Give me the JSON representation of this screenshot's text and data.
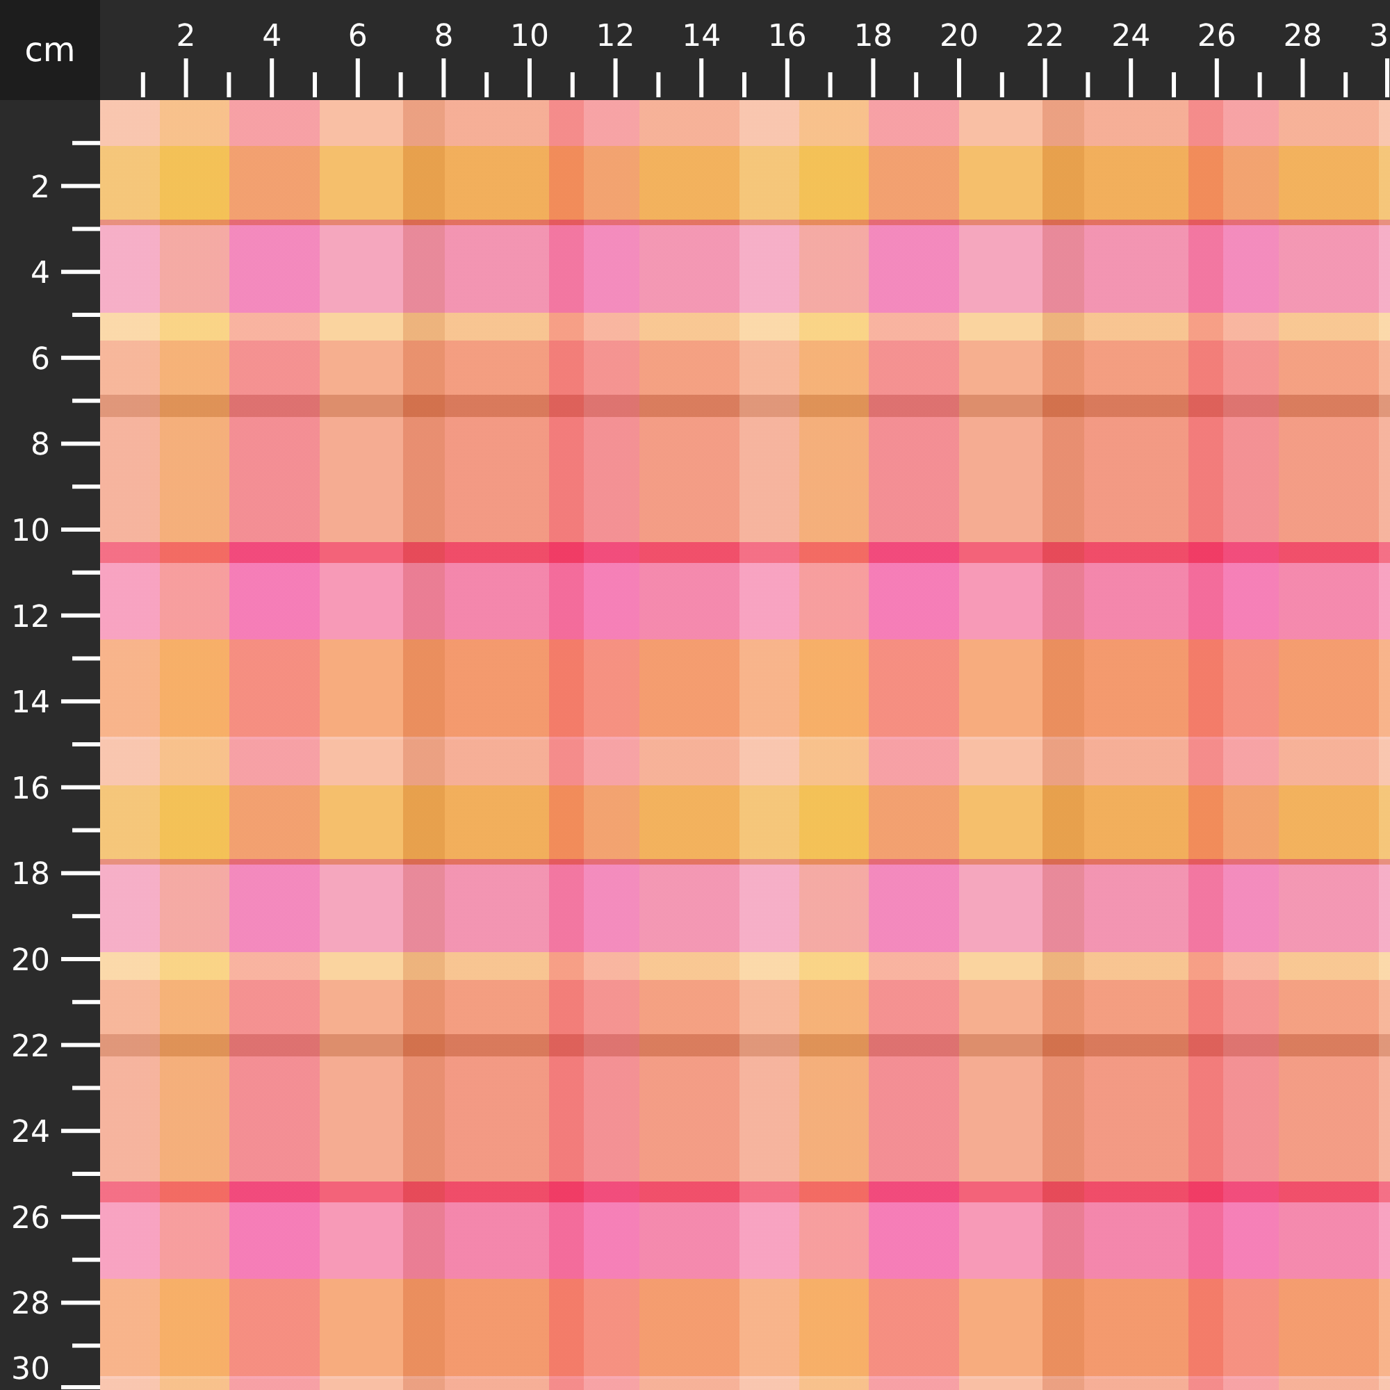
{
  "ruler": {
    "unit": "cm",
    "top_labels": [
      "2",
      "4",
      "6",
      "8",
      "10",
      "12",
      "14",
      "16",
      "18",
      "20",
      "22",
      "24",
      "26",
      "28",
      "3"
    ],
    "left_labels": [
      "2",
      "4",
      "6",
      "8",
      "10",
      "12",
      "14",
      "16",
      "18",
      "20",
      "22",
      "24",
      "26",
      "28",
      "30"
    ]
  }
}
